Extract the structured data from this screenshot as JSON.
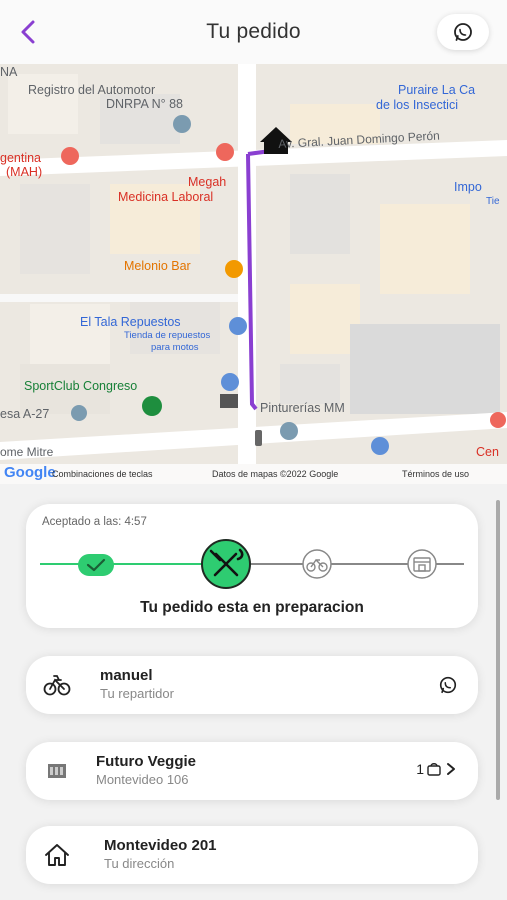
{
  "header": {
    "title": "Tu pedido",
    "back_icon": "chevron-left-icon",
    "whatsapp_icon": "whatsapp-icon",
    "accent_color": "#8a3fd1"
  },
  "map": {
    "labels": {
      "registro": "Registro del Automotor",
      "dnrpa": "DNRPA N° 88",
      "puraire1": "Puraire La Ca",
      "puraire2": "de los Insectici",
      "gentina1": "gentina",
      "gentina2": "(MAH)",
      "domingo": "Av. Gral. Juan Domingo Perón",
      "megah1": "Megah",
      "megah2": "Medicina Laboral",
      "impo1": "Impo",
      "impo2": "Tie",
      "melonio": "Melonio Bar",
      "tala1": "El Tala Repuestos",
      "tala2": "Tienda de repuestos",
      "tala3": "para motos",
      "sportclub": "SportClub Congreso",
      "pinturerias": "Pinturerías MM",
      "esa": "esa A-27",
      "mitre": "ome Mitre",
      "cen": "Cen",
      "na": "NA"
    },
    "footer": {
      "logo": "Google",
      "keys": "Combinaciones de teclas",
      "data": "Datos de mapas ©2022 Google",
      "terms": "Términos de uso"
    },
    "route_color": "#8a3fd1"
  },
  "status": {
    "accepted_label": "Aceptado a las: 4:57",
    "message": "Tu pedido esta en preparacion",
    "step_color": "#2ecc71",
    "steps": [
      {
        "icon": "check-icon",
        "state": "done"
      },
      {
        "icon": "utensils-icon",
        "state": "current"
      },
      {
        "icon": "bike-icon",
        "state": "pending"
      },
      {
        "icon": "store-icon",
        "state": "pending"
      }
    ]
  },
  "courier": {
    "name": "manuel",
    "role": "Tu repartidor",
    "icon": "bike-icon",
    "action_icon": "whatsapp-icon"
  },
  "store": {
    "name": "Futuro Veggie",
    "address": "Montevideo 106",
    "item_count": "1",
    "icon": "store-logo-icon",
    "bag_icon": "shopping-bag-icon",
    "chevron_icon": "chevron-right-icon"
  },
  "destination": {
    "address": "Montevideo 201",
    "label": "Tu dirección",
    "icon": "home-icon"
  }
}
